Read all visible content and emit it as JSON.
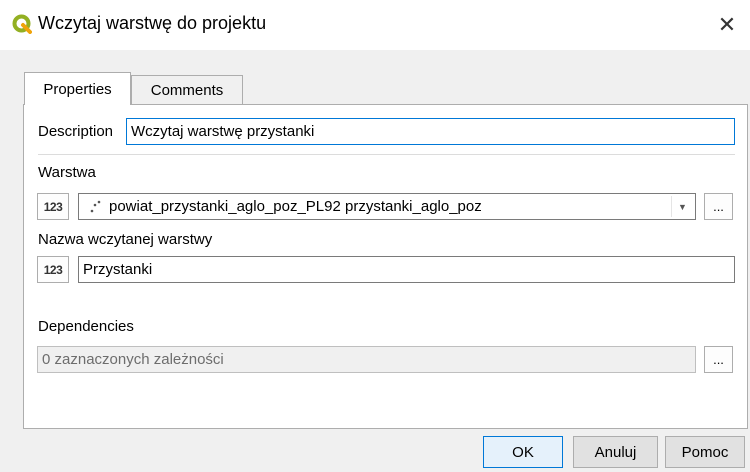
{
  "window": {
    "title": "Wczytaj warstwę do projektu",
    "close_glyph": "✕",
    "app_icon": "qgis-logo-icon"
  },
  "tabs": [
    {
      "label": "Properties",
      "active": true
    },
    {
      "label": "Comments",
      "active": false
    }
  ],
  "description": {
    "label": "Description",
    "value": "Wczytaj warstwę przystanki"
  },
  "layer": {
    "label": "Warstwa",
    "type_icon": "123",
    "value": "powiat_przystanki_aglo_poz_PL92 przystanki_aglo_poz",
    "browse_label": "..."
  },
  "loaded_name": {
    "label": "Nazwa wczytanej warstwy",
    "type_icon": "123",
    "value": "Przystanki"
  },
  "dependencies": {
    "label": "Dependencies",
    "value": "0 zaznaczonych zależności",
    "browse_label": "..."
  },
  "buttons": {
    "ok": "OK",
    "cancel": "Anuluj",
    "help": "Pomoc"
  },
  "colors": {
    "accent": "#0078d7",
    "qgis_green": "#93b023"
  }
}
